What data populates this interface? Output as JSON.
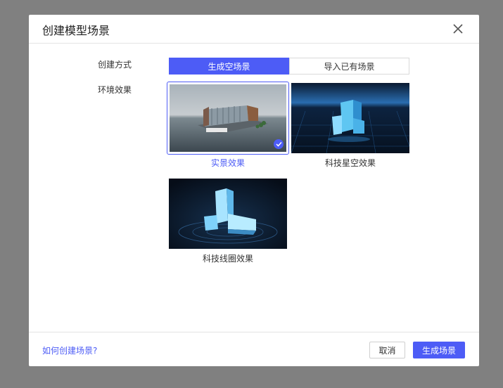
{
  "dialog": {
    "title": "创建模型场景",
    "close_icon": "close-icon"
  },
  "form": {
    "creation_mode_label": "创建方式",
    "environment_label": "环境效果"
  },
  "creation_mode": {
    "options": [
      "生成空场景",
      "导入已有场景"
    ],
    "selected": "生成空场景"
  },
  "effects": [
    {
      "label": "实景效果",
      "selected": true
    },
    {
      "label": "科技星空效果",
      "selected": false
    },
    {
      "label": "科技线圈效果",
      "selected": false
    }
  ],
  "footer": {
    "help_link": "如何创建场景?",
    "cancel_label": "取消",
    "confirm_label": "生成场景"
  },
  "colors": {
    "accent": "#4d5cf6",
    "overlay": "#808080",
    "selected_text": "#4d5cf6"
  }
}
